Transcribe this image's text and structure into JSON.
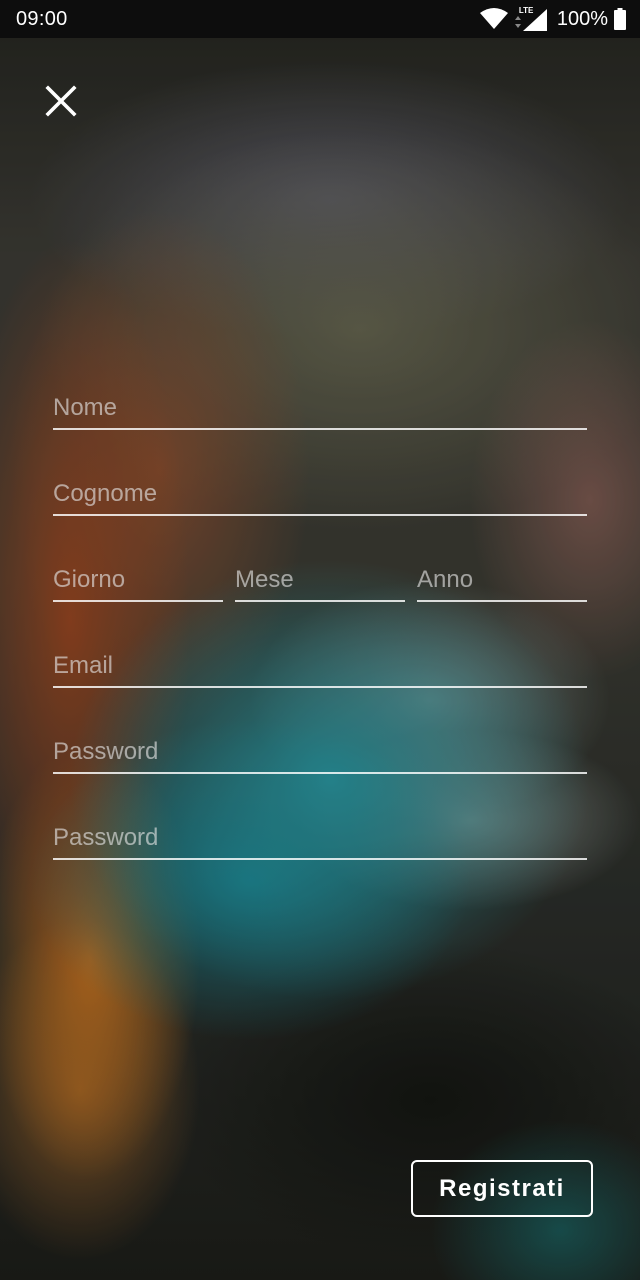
{
  "status_bar": {
    "time": "09:00",
    "network_label": "LTE",
    "battery": "100%",
    "icons": [
      "wifi-icon",
      "signal-icon",
      "battery-icon"
    ]
  },
  "form": {
    "close_icon": "close-icon",
    "nome_placeholder": "Nome",
    "cognome_placeholder": "Cognome",
    "giorno_placeholder": "Giorno",
    "mese_placeholder": "Mese",
    "anno_placeholder": "Anno",
    "email_placeholder": "Email",
    "password_placeholder": "Password",
    "password_confirm_placeholder": "Password",
    "register_label": "Registrati"
  },
  "colors": {
    "status_bar_bg": "#0d0d0d",
    "text": "#ffffff",
    "underline": "#ffffff"
  }
}
